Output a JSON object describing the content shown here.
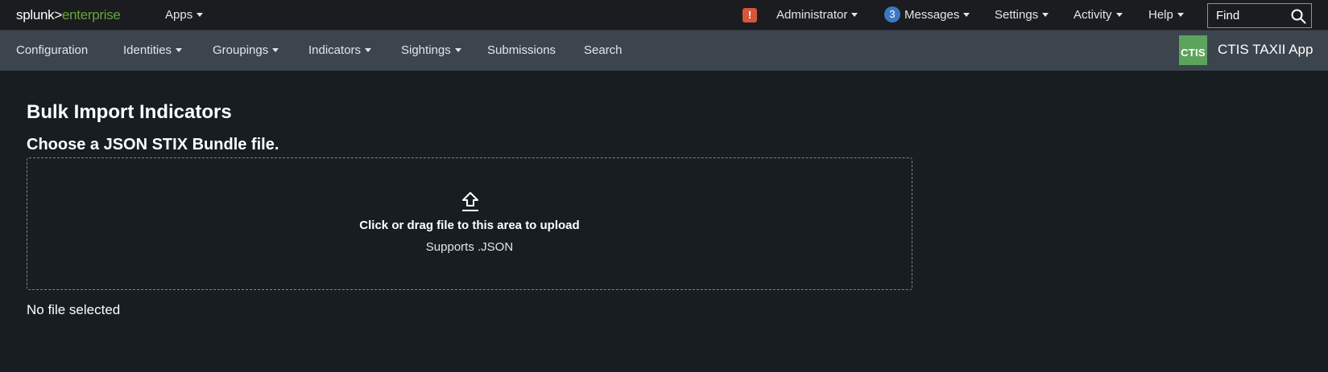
{
  "topbar": {
    "logo_left": "splunk>",
    "logo_right": "enterprise",
    "apps_label": "Apps",
    "alert_icon": "alert-icon",
    "alert_glyph": "!",
    "user_label": "Administrator",
    "messages_count": "3",
    "messages_label": "Messages",
    "settings_label": "Settings",
    "activity_label": "Activity",
    "help_label": "Help",
    "find_placeholder": "Find",
    "search_icon": "search-icon"
  },
  "appbar": {
    "items": [
      {
        "label": "Configuration"
      },
      {
        "label": "Identities"
      },
      {
        "label": "Groupings"
      },
      {
        "label": "Indicators"
      },
      {
        "label": "Sightings"
      },
      {
        "label": "Submissions"
      },
      {
        "label": "Search"
      }
    ],
    "app_logo_text": "CTIS",
    "app_name": "CTIS TAXII App"
  },
  "main": {
    "title": "Bulk Import Indicators",
    "subtitle": "Choose a JSON STIX Bundle file.",
    "dropzone": {
      "icon": "upload-icon",
      "text": "Click or drag file to this area to upload",
      "hint": "Supports .JSON"
    },
    "file_status": "No file selected"
  },
  "colors": {
    "background": "#171d21",
    "topbar": "#1a1c20",
    "appbar": "#3c444d",
    "splunk_green": "#65a637",
    "alert_red": "#d6563c",
    "badge_blue": "#3c77c4",
    "app_logo_green": "#5ca35c"
  }
}
